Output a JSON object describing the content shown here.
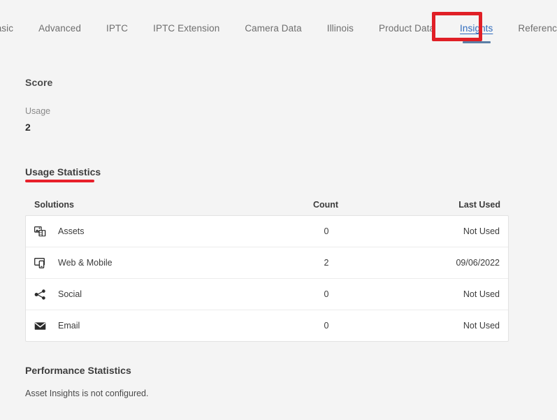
{
  "tabs": [
    {
      "label": "Basic",
      "selected": false
    },
    {
      "label": "Advanced",
      "selected": false
    },
    {
      "label": "IPTC",
      "selected": false
    },
    {
      "label": "IPTC Extension",
      "selected": false
    },
    {
      "label": "Camera Data",
      "selected": false
    },
    {
      "label": "Illinois",
      "selected": false
    },
    {
      "label": "Product Data",
      "selected": false
    },
    {
      "label": "Insights",
      "selected": true
    },
    {
      "label": "References",
      "selected": false
    }
  ],
  "score": {
    "title": "Score",
    "usage_label": "Usage",
    "usage_value": "2"
  },
  "usage_statistics": {
    "title": "Usage Statistics",
    "columns": {
      "solutions": "Solutions",
      "count": "Count",
      "last_used": "Last Used"
    },
    "rows": [
      {
        "icon": "assets-icon",
        "solution": "Assets",
        "count": "0",
        "last_used": "Not Used"
      },
      {
        "icon": "web-mobile-icon",
        "solution": "Web & Mobile",
        "count": "2",
        "last_used": "09/06/2022"
      },
      {
        "icon": "social-share-icon",
        "solution": "Social",
        "count": "0",
        "last_used": "Not Used"
      },
      {
        "icon": "email-icon",
        "solution": "Email",
        "count": "0",
        "last_used": "Not Used"
      }
    ]
  },
  "performance_statistics": {
    "title": "Performance Statistics",
    "message": "Asset Insights is not configured."
  },
  "colors": {
    "annotation_red": "#e01f26",
    "tab_selected_blue": "#2f6bbd",
    "tab_indicator_blue": "#5b7fa6",
    "page_background": "#f4f4f4",
    "card_background": "#ffffff"
  }
}
